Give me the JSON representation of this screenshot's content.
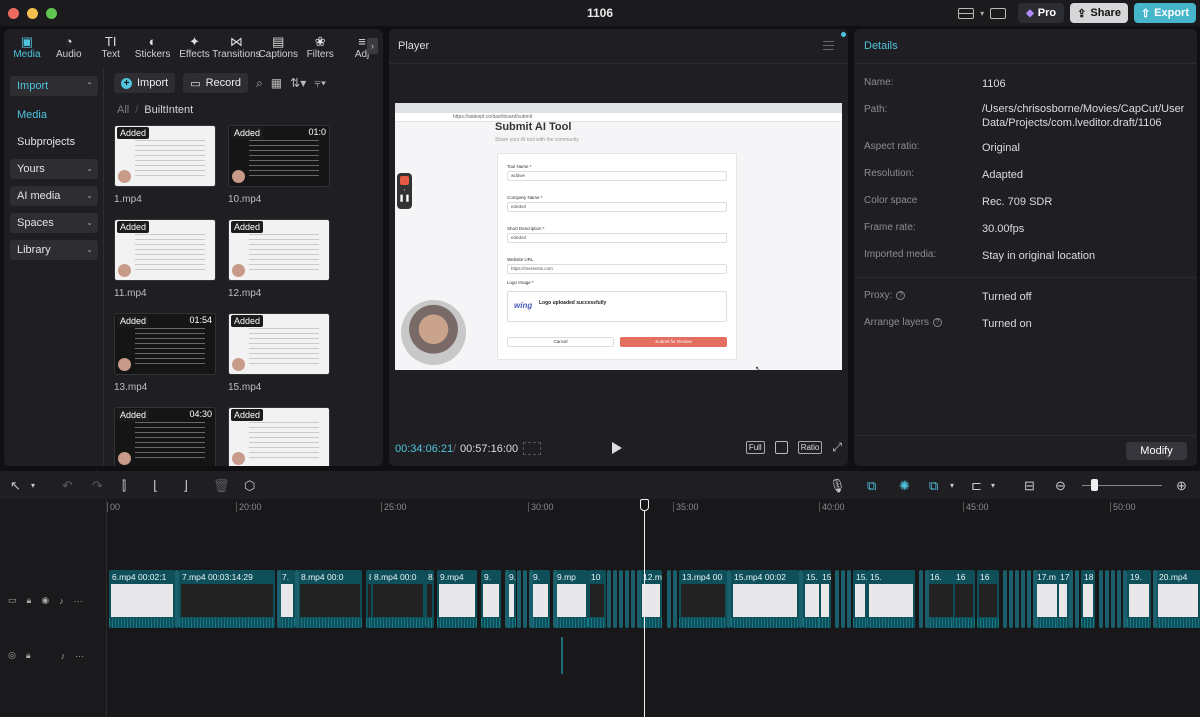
{
  "window": {
    "title": "1106"
  },
  "titlebar": {
    "pro_label": "Pro",
    "share_label": "Share",
    "export_label": "Export"
  },
  "tabs": [
    {
      "label": "Media",
      "icon": "media-icon",
      "glyph": "▣"
    },
    {
      "label": "Audio",
      "icon": "audio-icon",
      "glyph": "◔"
    },
    {
      "label": "Text",
      "icon": "text-icon",
      "glyph": "TI"
    },
    {
      "label": "Stickers",
      "icon": "stickers-icon",
      "glyph": "◐"
    },
    {
      "label": "Effects",
      "icon": "effects-icon",
      "glyph": "✦"
    },
    {
      "label": "Transitions",
      "icon": "transitions-icon",
      "glyph": "⋈"
    },
    {
      "label": "Captions",
      "icon": "captions-icon",
      "glyph": "▤"
    },
    {
      "label": "Filters",
      "icon": "filters-icon",
      "glyph": "❀"
    },
    {
      "label": "Adj",
      "icon": "adjust-icon",
      "glyph": "≡"
    }
  ],
  "sidebar": {
    "items": [
      {
        "label": "Import",
        "chevron": "⌃"
      },
      {
        "label": "Media",
        "chevron": ""
      },
      {
        "label": "Subprojects",
        "chevron": ""
      },
      {
        "label": "Yours",
        "chevron": "⌄"
      },
      {
        "label": "AI media",
        "chevron": "⌄"
      },
      {
        "label": "Spaces",
        "chevron": "⌄"
      },
      {
        "label": "Library",
        "chevron": "⌄"
      }
    ]
  },
  "media_toolbar": {
    "import_label": "Import",
    "record_label": "Record"
  },
  "breadcrumb": {
    "root": "All",
    "sep": "/",
    "current": "BuiltIntent"
  },
  "media_items": [
    {
      "name": "1.mp4",
      "badge": "Added",
      "duration": "",
      "dark": false
    },
    {
      "name": "10.mp4",
      "badge": "Added",
      "duration": "01:0",
      "dark": true
    },
    {
      "name": "11.mp4",
      "badge": "Added",
      "duration": "",
      "dark": false
    },
    {
      "name": "12.mp4",
      "badge": "Added",
      "duration": "",
      "dark": false
    },
    {
      "name": "13.mp4",
      "badge": "Added",
      "duration": "01:54",
      "dark": true
    },
    {
      "name": "15.mp4",
      "badge": "Added",
      "duration": "",
      "dark": false
    },
    {
      "name": "",
      "badge": "Added",
      "duration": "04:30",
      "dark": true
    },
    {
      "name": "",
      "badge": "Added",
      "duration": "",
      "dark": false
    }
  ],
  "player": {
    "title": "Player",
    "current_time": "00:34:06:21",
    "total_time": "00:57:16:00",
    "full_label": "Full",
    "ratio_label": "Ratio",
    "video": {
      "url": "https://aideept.co/dashboard/submit",
      "heading": "Submit AI Tool",
      "subheading": "Share your AI tool with the community",
      "fields": [
        {
          "label": "Tool Name *",
          "value": "wddwe"
        },
        {
          "label": "Company Name *",
          "value": "ededed"
        },
        {
          "label": "Short Description *",
          "value": "ededed"
        },
        {
          "label": "Website URL",
          "value": "https://mersents.com"
        }
      ],
      "logo_label": "Logo Image *",
      "logo_brand": "wing",
      "logo_status": "Logo uploaded successfully",
      "cancel_label": "Cancel",
      "submit_label": "Submit for Review"
    }
  },
  "details": {
    "title": "Details",
    "rows": [
      {
        "key": "Name:",
        "value": "1106",
        "info": ""
      },
      {
        "key": "Path:",
        "value": "/Users/chrisosborne/Movies/CapCut/User Data/Projects/com.lveditor.draft/1106",
        "info": ""
      },
      {
        "key": "Aspect ratio:",
        "value": "Original",
        "info": ""
      },
      {
        "key": "Resolution:",
        "value": "Adapted",
        "info": ""
      },
      {
        "key": "Color space",
        "value": "Rec. 709 SDR",
        "info": ""
      },
      {
        "key": "Frame rate:",
        "value": "30.00fps",
        "info": ""
      },
      {
        "key": "Imported media:",
        "value": "Stay in original location",
        "info": ""
      },
      {
        "key": "Proxy:",
        "value": "Turned off",
        "info": "?"
      },
      {
        "key": "Arrange layers",
        "value": "Turned on",
        "info": "?"
      }
    ],
    "modify_label": "Modify"
  },
  "timeline": {
    "ruler": [
      "00",
      "20:00",
      "25:00",
      "30:00",
      "35:00",
      "40:00",
      "45:00",
      "50:00"
    ],
    "clips": [
      {
        "name": "6.mp4   00:02:1",
        "dark": false
      },
      {
        "name": "7.mp4   00:03:14:29",
        "dark": true
      },
      {
        "name": "7.",
        "dark": false
      },
      {
        "name": "8.mp4   00:0",
        "dark": true
      },
      {
        "name": "8.",
        "dark": true
      },
      {
        "name": "8.mp4   00:0",
        "dark": true
      },
      {
        "name": "8.",
        "dark": true
      },
      {
        "name": "9.mp4",
        "dark": false
      },
      {
        "name": "9.",
        "dark": false
      },
      {
        "name": "9.",
        "dark": false
      },
      {
        "name": "9.",
        "dark": false
      },
      {
        "name": "9.mp",
        "dark": false
      },
      {
        "name": "10",
        "dark": true
      },
      {
        "name": "12.m",
        "dark": false
      },
      {
        "name": "13.mp4   00",
        "dark": true
      },
      {
        "name": "15.mp4   00:02",
        "dark": false
      },
      {
        "name": "15.",
        "dark": false
      },
      {
        "name": "15",
        "dark": false
      },
      {
        "name": "15.mp4",
        "dark": false
      },
      {
        "name": "15.",
        "dark": false
      },
      {
        "name": "16.",
        "dark": true
      },
      {
        "name": "16",
        "dark": true
      },
      {
        "name": "16",
        "dark": true
      },
      {
        "name": "17.m",
        "dark": false
      },
      {
        "name": "17.",
        "dark": false
      },
      {
        "name": "18",
        "dark": false
      },
      {
        "name": "19.",
        "dark": false
      },
      {
        "name": "20.mp4",
        "dark": false
      }
    ]
  }
}
